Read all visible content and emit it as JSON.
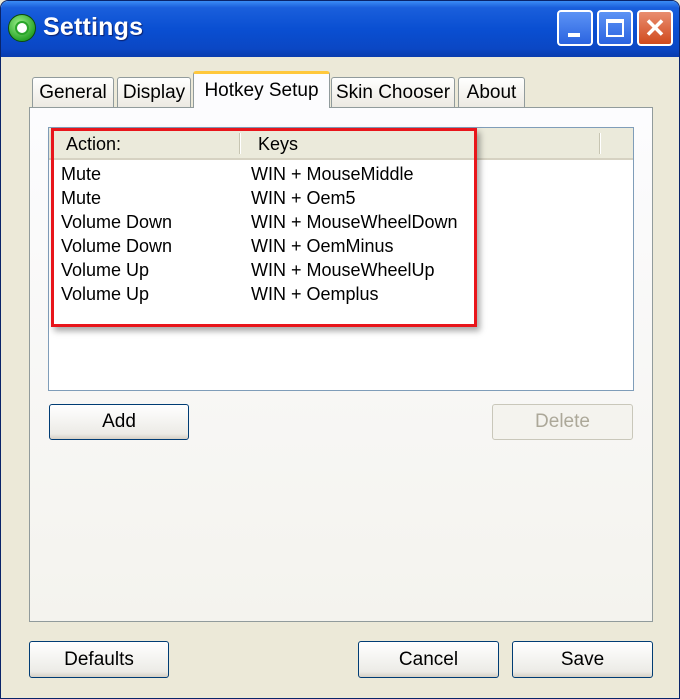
{
  "window": {
    "title": "Settings"
  },
  "tabs": [
    {
      "label": "General"
    },
    {
      "label": "Display"
    },
    {
      "label": "Hotkey Setup"
    },
    {
      "label": "Skin Chooser"
    },
    {
      "label": "About"
    }
  ],
  "active_tab": "Hotkey Setup",
  "hotkeys": {
    "columns": {
      "action": "Action:",
      "keys": "Keys"
    },
    "rows": [
      {
        "action": "Mute",
        "keys": "WIN + MouseMiddle"
      },
      {
        "action": "Mute",
        "keys": "WIN + Oem5"
      },
      {
        "action": "Volume Down",
        "keys": "WIN + MouseWheelDown"
      },
      {
        "action": "Volume Down",
        "keys": "WIN + OemMinus"
      },
      {
        "action": "Volume Up",
        "keys": "WIN + MouseWheelUp"
      },
      {
        "action": "Volume Up",
        "keys": "WIN + Oemplus"
      }
    ],
    "add_label": "Add",
    "delete_label": "Delete",
    "delete_enabled": false
  },
  "footer": {
    "defaults_label": "Defaults",
    "cancel_label": "Cancel",
    "save_label": "Save"
  },
  "colors": {
    "titlebar": "#0a4fd2",
    "highlight_border": "#e8151b",
    "active_tab_accent": "#ffc83c"
  }
}
